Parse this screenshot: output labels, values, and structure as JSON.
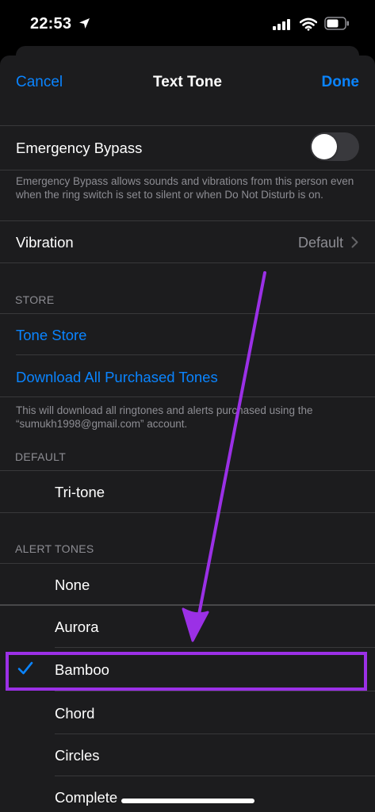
{
  "status_bar": {
    "time": "22:53"
  },
  "nav": {
    "cancel": "Cancel",
    "title": "Text Tone",
    "done": "Done"
  },
  "emergency_bypass": {
    "label": "Emergency Bypass",
    "enabled": false,
    "footnote": "Emergency Bypass allows sounds and vibrations from this person even when the ring switch is set to silent or when Do Not Disturb is on."
  },
  "vibration": {
    "label": "Vibration",
    "value": "Default"
  },
  "store": {
    "header": "STORE",
    "tone_store": "Tone Store",
    "download_all": "Download All Purchased Tones",
    "footnote": "This will download all ringtones and alerts purchased using the “sumukh1998@gmail.com” account."
  },
  "default_section": {
    "header": "DEFAULT",
    "item": "Tri-tone"
  },
  "alert_tones": {
    "header": "ALERT TONES",
    "items": [
      "None",
      "Aurora",
      "Bamboo",
      "Chord",
      "Circles",
      "Complete"
    ],
    "selected": "Bamboo"
  },
  "colors": {
    "accent": "#0a84ff",
    "annotation": "#9b30e6"
  },
  "icons": [
    "location-arrow-icon",
    "signal-icon",
    "wifi-icon",
    "battery-icon",
    "chevron-right-icon",
    "checkmark-icon",
    "annotation-arrow"
  ]
}
